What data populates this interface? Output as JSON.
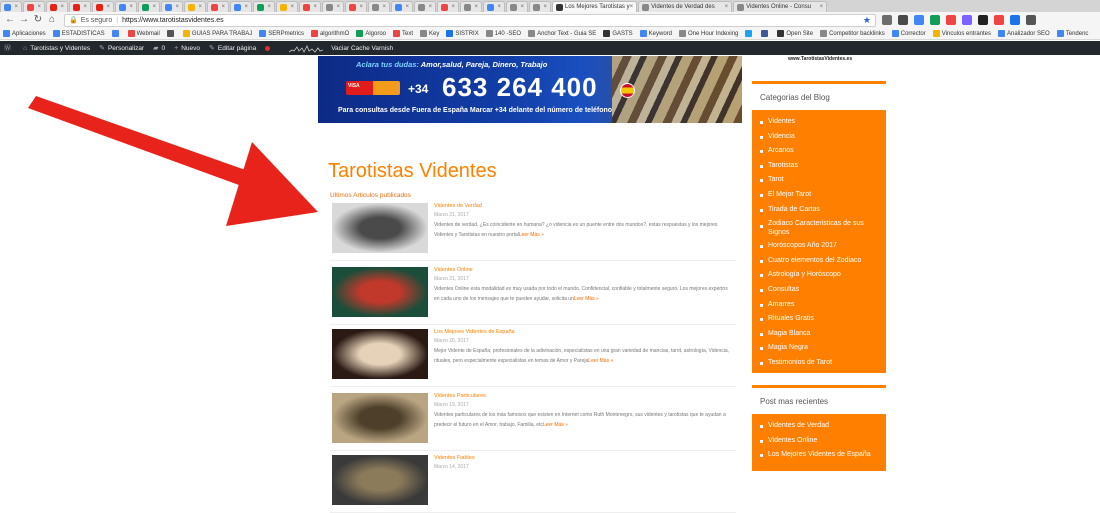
{
  "browser": {
    "tabs": [
      {
        "label": "",
        "color": "#4285f4",
        "type": "mini"
      },
      {
        "label": "W",
        "color": "#e44",
        "type": "mini"
      },
      {
        "label": "",
        "color": "#e62117",
        "type": "mini"
      },
      {
        "label": "",
        "color": "#e62117",
        "type": "mini"
      },
      {
        "label": "",
        "color": "#e62117",
        "type": "mini"
      },
      {
        "label": "",
        "color": "#4285f4",
        "type": "mini"
      },
      {
        "label": "",
        "color": "#0f9d58",
        "type": "mini"
      },
      {
        "label": "",
        "color": "#4285f4",
        "type": "mini"
      },
      {
        "label": "",
        "color": "#f4b400",
        "type": "mini"
      },
      {
        "label": "",
        "color": "#e44",
        "type": "mini"
      },
      {
        "label": "",
        "color": "#4285f4",
        "type": "mini"
      },
      {
        "label": "",
        "color": "#0f9d58",
        "type": "mini"
      },
      {
        "label": "",
        "color": "#f4b400",
        "type": "mini"
      },
      {
        "label": "",
        "color": "#e44",
        "type": "mini"
      },
      {
        "label": "",
        "color": "#888",
        "type": "mini"
      },
      {
        "label": "",
        "color": "#e44",
        "type": "mini"
      },
      {
        "label": "",
        "color": "#888",
        "type": "mini"
      },
      {
        "label": "",
        "color": "#4285f4",
        "type": "mini"
      },
      {
        "label": "",
        "color": "#888",
        "type": "mini"
      },
      {
        "label": "",
        "color": "#e44",
        "type": "mini"
      },
      {
        "label": "",
        "color": "#888",
        "type": "mini"
      },
      {
        "label": "",
        "color": "#4285f4",
        "type": "mini"
      },
      {
        "label": "",
        "color": "#888",
        "type": "mini"
      },
      {
        "label": "",
        "color": "#888",
        "type": "mini"
      },
      {
        "label": "Los Mejores Tarotistas y",
        "color": "#333",
        "type": "active"
      },
      {
        "label": "Videntes de Verdad des",
        "color": "#888",
        "type": "wide"
      },
      {
        "label": "Videntes Online - Consu",
        "color": "#888",
        "type": "wide"
      }
    ],
    "address": {
      "secure_label": "Es seguro",
      "url": "https://www.tarotistasvidentes.es"
    },
    "nav": {
      "back": "←",
      "forward": "→",
      "reload": "↻",
      "home": "⌂"
    },
    "bookmarks": [
      {
        "label": "Aplicaciones",
        "color": "#4285f4"
      },
      {
        "label": "ESTADISTICAS",
        "color": "#4285f4"
      },
      {
        "label": "",
        "color": "#4285f4"
      },
      {
        "label": "Webmail",
        "color": "#e44"
      },
      {
        "label": "",
        "color": "#555"
      },
      {
        "label": "GUIAS PARA TRABAJ",
        "color": "#f4b400"
      },
      {
        "label": "SERPmetrics",
        "color": "#4285f4"
      },
      {
        "label": "algorithmO",
        "color": "#e44"
      },
      {
        "label": "Algoroo",
        "color": "#0f9d58"
      },
      {
        "label": "Text",
        "color": "#e44"
      },
      {
        "label": "Key",
        "color": "#888"
      },
      {
        "label": "SISTRIX",
        "color": "#1a73e8"
      },
      {
        "label": "140 -SEO",
        "color": "#888"
      },
      {
        "label": "Anchor Text - Guia SE",
        "color": "#888"
      },
      {
        "label": "GASTS",
        "color": "#333"
      },
      {
        "label": "Keyword",
        "color": "#4285f4"
      },
      {
        "label": "One Hour Indexing",
        "color": "#888"
      },
      {
        "label": "",
        "color": "#1da1f2"
      },
      {
        "label": "",
        "color": "#3b5998"
      },
      {
        "label": "Open Site",
        "color": "#333"
      },
      {
        "label": "Competitor backlinks",
        "color": "#888"
      },
      {
        "label": "Corrector",
        "color": "#4285f4"
      },
      {
        "label": "Vinculos entrantes",
        "color": "#f4b400"
      },
      {
        "label": "Analizador SEO",
        "color": "#4285f4"
      },
      {
        "label": "Tendenc",
        "color": "#4285f4"
      }
    ],
    "extensions": [
      "#6d6d6d",
      "#4a4a4a",
      "#4285f4",
      "#0f9d58",
      "#e44",
      "#7b61ff",
      "#222",
      "#e44",
      "#1a73e8",
      "#555"
    ]
  },
  "wp_admin": {
    "site_name": "Tarotistas y Videntes",
    "customize": "Personalizar",
    "comments": "0",
    "new": "Nuevo",
    "edit": "Editar página",
    "cache": "Vaciar Cache Varnish"
  },
  "banner": {
    "tagline_prefix": "Aclara tus dudas:",
    "tagline": "Amor,salud, Pareja, Dinero, Trabajo",
    "pay_label": "VISA",
    "prefix": "+34",
    "phone": "633 264 400",
    "footer": "Para consultas desde Fuera de España Marcar +34 delante del número de teléfono"
  },
  "main": {
    "title": "Tarotistas Videntes",
    "subtitle": "Ultimos Articulos publicados",
    "more_label": "Leer Más »",
    "posts": [
      {
        "title": "Videntes de Verdad",
        "date": "Marzo 21, 2017",
        "excerpt": "Videntes de verdad. ¿Es coincidente en humana? ¿o videncia es un puente entre dos mundos?, estas respuestas y los mejores Videntes y Tarotistas en nuestro portal",
        "thumb_colors": [
          "#d9d9d9",
          "#4a4a4a"
        ]
      },
      {
        "title": "Videntes Online",
        "date": "Marzo 21, 2017",
        "excerpt": "Videntes Online esta modalidad es muy usada por todo el mundo. Confidencial, confiable y totalmente seguro. Los mejores expertos en cada uno de los mensajes que te pueden ayudar, solicita un",
        "thumb_colors": [
          "#1a4d3a",
          "#c0392b"
        ]
      },
      {
        "title": "Los Mejores Videntes de España",
        "date": "Marzo 20, 2017",
        "excerpt": "Mejor Vidente de España; profesionales de la adivinación, especialistas en una gran variedad de mancias, tarot, astrología, Videncia, rituales, pero especialmente especialistas en temas de Amor y Pareja",
        "thumb_colors": [
          "#2b1a14",
          "#e6d2b8"
        ]
      },
      {
        "title": "Videntes Particulares",
        "date": "Marzo 19, 2017",
        "excerpt": "Videntes particulares de los más famosos que existen en Internet como Ruth Montenegro, sus videntes y tarotistas que te ayudan a predecir el futuro en el Amor, trabajo, Familia, etc",
        "thumb_colors": [
          "#b9a582",
          "#4d3f2a"
        ]
      },
      {
        "title": "Videntes Fiables",
        "date": "Marzo 14, 2017",
        "excerpt": "",
        "thumb_colors": [
          "#3a3a3a",
          "#8c7b5a"
        ]
      }
    ]
  },
  "sidebar": {
    "url_caption": "www.TarotistasVidentes.es",
    "categories_title": "Categorias del Blog",
    "categories": [
      "Videntes",
      "Videncia",
      "Arcanos",
      "Tarotistas",
      "Tarot",
      "El Mejor Tarot",
      "Tirada de Cartas",
      "Zodiaco Caracteristicas de sus Signos",
      "Horóscopos Año 2017",
      "Cuatro elementos del Zodiaco",
      "Astrología y Horóscopo",
      "Consultas",
      "Amarres",
      "Rituales Gratis",
      "Magia Blanca",
      "Magia Negra",
      "Testimonios de Tarot"
    ],
    "recent_title": "Post mas recientes",
    "recent": [
      "Videntes de Verdad",
      "Videntes Online",
      "Los Mejores Videntes de España"
    ]
  },
  "colors": {
    "accent": "#ff8000",
    "arrow": "#e8231b",
    "wp_bar": "#23282d"
  }
}
